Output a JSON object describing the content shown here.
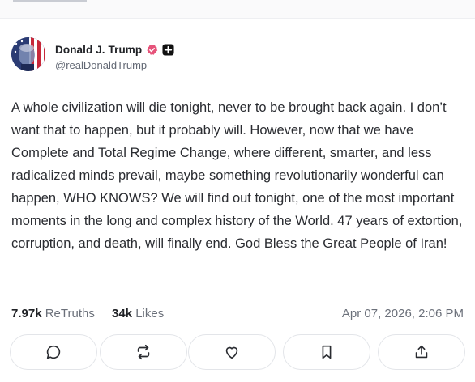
{
  "author": {
    "display_name": "Donald J. Trump",
    "handle": "@realDonaldTrump",
    "verified_color": "#e6537a",
    "plus_badge_color": "#111111"
  },
  "post": {
    "text": "A whole civilization will die tonight, never to be brought back again. I don’t want that to happen, but it probably will. However, now that we have Complete and Total Regime Change, where different, smarter, and less radicalized minds prevail, maybe something revolutionarily wonderful can happen, WHO KNOWS? We will find out tonight, one of the most important moments in the long and complex history of the World. 47 years of extortion, corruption, and death, will finally end. God Bless the Great People of Iran!"
  },
  "stats": {
    "retruths_count": "7.97k",
    "retruths_label": "ReTruths",
    "likes_count": "34k",
    "likes_label": "Likes",
    "timestamp": "Apr 07, 2026, 2:06 PM"
  },
  "actions": [
    {
      "name": "reply",
      "icon": "comment-icon"
    },
    {
      "name": "retruth",
      "icon": "repost-icon"
    },
    {
      "name": "like",
      "icon": "heart-icon"
    },
    {
      "name": "save",
      "icon": "bookmark-icon"
    },
    {
      "name": "share",
      "icon": "share-icon"
    }
  ]
}
